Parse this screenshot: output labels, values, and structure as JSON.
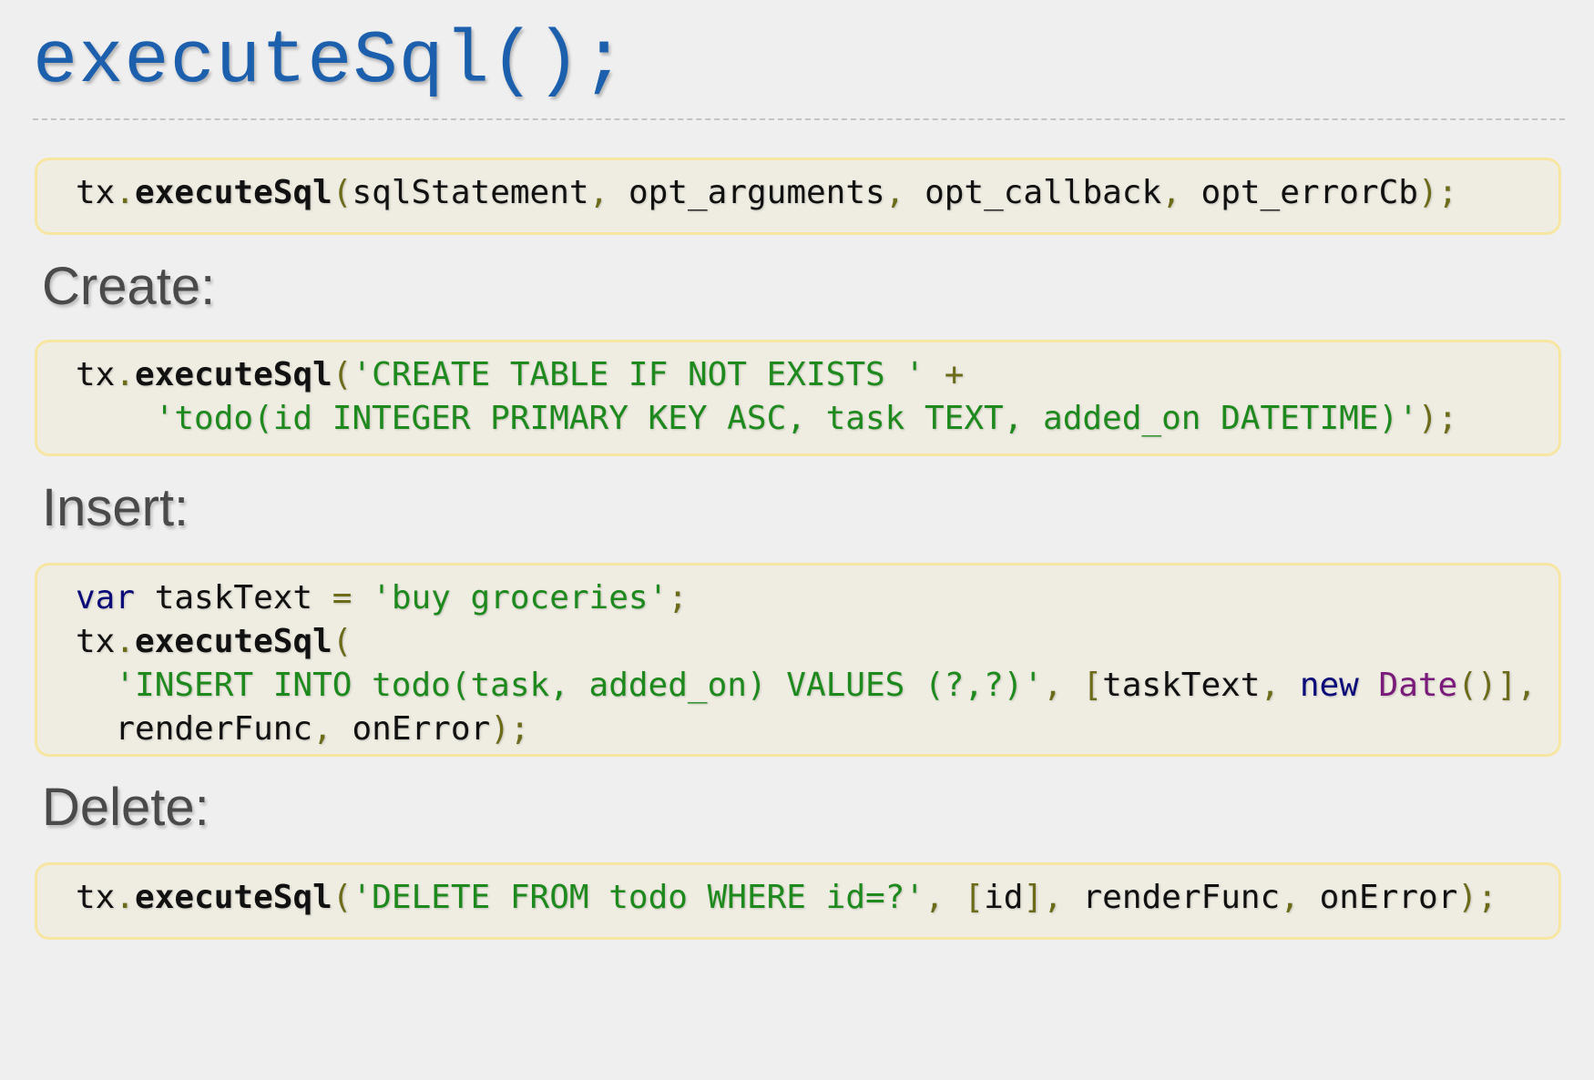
{
  "title": "executeSql();",
  "sections": {
    "create_heading": "Create:",
    "insert_heading": "Insert:",
    "delete_heading": "Delete:"
  },
  "code": {
    "signature": {
      "obj": "tx",
      "dot": ".",
      "fn": "executeSql",
      "open": "(",
      "a1": "sqlStatement",
      "c1": ",",
      "a2": " opt_arguments",
      "c2": ",",
      "a3": " opt_callback",
      "c3": ",",
      "a4": " opt_errorCb",
      "close": ");"
    },
    "create": {
      "l1_obj": "tx",
      "l1_dot": ".",
      "l1_fn": "executeSql",
      "l1_open": "(",
      "l1_str": "'CREATE TABLE IF NOT EXISTS '",
      "l1_plus": " +",
      "l2_indent": "    ",
      "l2_str": "'todo(id INTEGER PRIMARY KEY ASC, task TEXT, added_on DATETIME)'",
      "l2_close": ");"
    },
    "insert": {
      "l1_kw": "var",
      "l1_name": " taskText ",
      "l1_eq": "=",
      "l1_str": " 'buy groceries'",
      "l1_semi": ";",
      "l2_obj": "tx",
      "l2_dot": ".",
      "l2_fn": "executeSql",
      "l2_open": "(",
      "l3_indent": "  ",
      "l3_str": "'INSERT INTO todo(task, added_on) VALUES (?,?)'",
      "l3_comma": ",",
      "l3_br_open": " [",
      "l3_var": "taskText",
      "l3_comma2": ",",
      "l3_new": " new",
      "l3_cls": " Date",
      "l3_tail": "()],",
      "l4_indent": "  ",
      "l4_a": "renderFunc",
      "l4_comma": ",",
      "l4_b": " onError",
      "l4_close": ");"
    },
    "delete": {
      "obj": "tx",
      "dot": ".",
      "fn": "executeSql",
      "open": "(",
      "str": "'DELETE FROM todo WHERE id=?'",
      "comma1": ",",
      "br_open": " [",
      "id": "id",
      "br_close": "]",
      "comma2": ",",
      "a": " renderFunc",
      "comma3": ",",
      "b": " onError",
      "close": ");"
    }
  },
  "colors": {
    "title": "#1c5fad",
    "keyword": "#0b0b7a",
    "string": "#1e8a1e",
    "punctuation": "#6b6b1a",
    "class": "#7a1a7a",
    "code_bg": "#efede2",
    "code_border": "#f7e6a2"
  }
}
